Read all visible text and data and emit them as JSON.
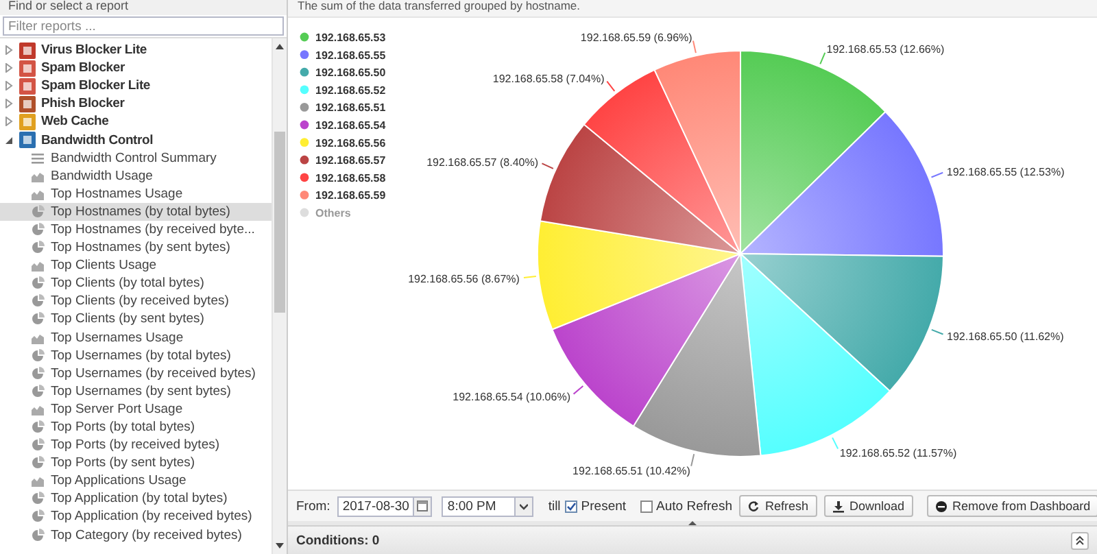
{
  "sidebar": {
    "title": "Find or select a report",
    "filter": {
      "placeholder": "Filter reports ..."
    },
    "tree": [
      {
        "label": "Virus Blocker Lite",
        "expanded": false,
        "selected": false
      },
      {
        "label": "Spam Blocker",
        "expanded": false,
        "selected": false
      },
      {
        "label": "Spam Blocker Lite",
        "expanded": false,
        "selected": false
      },
      {
        "label": "Phish Blocker",
        "expanded": false,
        "selected": false
      },
      {
        "label": "Web Cache",
        "expanded": false,
        "selected": false
      },
      {
        "label": "Bandwidth Control",
        "expanded": true,
        "selected": false,
        "children": [
          {
            "label": "Bandwidth Control Summary",
            "kind": "text",
            "selected": false
          },
          {
            "label": "Bandwidth Usage",
            "kind": "area",
            "selected": false
          },
          {
            "label": "Top Hostnames Usage",
            "kind": "area",
            "selected": false
          },
          {
            "label": "Top Hostnames (by total bytes)",
            "kind": "pie",
            "selected": true
          },
          {
            "label": "Top Hostnames (by received byte...",
            "kind": "pie",
            "selected": false
          },
          {
            "label": "Top Hostnames (by sent bytes)",
            "kind": "pie",
            "selected": false
          },
          {
            "label": "Top Clients Usage",
            "kind": "area",
            "selected": false
          },
          {
            "label": "Top Clients (by total bytes)",
            "kind": "pie",
            "selected": false
          },
          {
            "label": "Top Clients (by received bytes)",
            "kind": "pie",
            "selected": false
          },
          {
            "label": "Top Clients (by sent bytes)",
            "kind": "pie",
            "selected": false
          },
          {
            "label": "Top Usernames Usage",
            "kind": "area",
            "selected": false
          },
          {
            "label": "Top Usernames (by total bytes)",
            "kind": "pie",
            "selected": false
          },
          {
            "label": "Top Usernames (by received bytes)",
            "kind": "pie",
            "selected": false
          },
          {
            "label": "Top Usernames (by sent bytes)",
            "kind": "pie",
            "selected": false
          },
          {
            "label": "Top Server Port Usage",
            "kind": "area",
            "selected": false
          },
          {
            "label": "Top Ports (by total bytes)",
            "kind": "pie",
            "selected": false
          },
          {
            "label": "Top Ports (by received bytes)",
            "kind": "pie",
            "selected": false
          },
          {
            "label": "Top Ports (by sent bytes)",
            "kind": "pie",
            "selected": false
          },
          {
            "label": "Top Applications Usage",
            "kind": "area",
            "selected": false
          },
          {
            "label": "Top Application (by total bytes)",
            "kind": "pie",
            "selected": false
          },
          {
            "label": "Top Application (by received bytes)",
            "kind": "pie",
            "selected": false
          },
          {
            "label": "Top Category (by received bytes)",
            "kind": "pie",
            "selected": false
          }
        ]
      }
    ]
  },
  "report": {
    "description": "The sum of the data transferred grouped by hostname.",
    "slices": [
      {
        "color": "#55cc55",
        "hidden": false
      },
      {
        "color": "#7777ff",
        "hidden": false
      },
      {
        "color": "#44aaaa",
        "hidden": false
      },
      {
        "color": "#55ffff",
        "hidden": false
      },
      {
        "color": "#999999",
        "hidden": false
      },
      {
        "color": "#bb44cc",
        "hidden": false
      },
      {
        "color": "#ffee33",
        "hidden": false
      },
      {
        "color": "#bb4444",
        "hidden": false
      },
      {
        "color": "#ff4444",
        "hidden": false
      },
      {
        "color": "#ff8877",
        "hidden": false
      },
      {
        "color": "#dddddd",
        "hidden": true
      }
    ],
    "chart_data": {
      "type": "pie",
      "legend": true,
      "categories": [
        "192.168.65.53",
        "192.168.65.55",
        "192.168.65.50",
        "192.168.65.52",
        "192.168.65.51",
        "192.168.65.54",
        "192.168.65.56",
        "192.168.65.57",
        "192.168.65.58",
        "192.168.65.59",
        "Others"
      ],
      "values": [
        12.66,
        12.53,
        11.62,
        11.57,
        10.42,
        10.06,
        8.67,
        8.4,
        7.04,
        6.96,
        null
      ],
      "value_labels": [
        "192.168.65.53 (12.66%)",
        "192.168.65.55 (12.53%)",
        "192.168.65.50 (11.62%)",
        "192.168.65.52 (11.57%)",
        "192.168.65.51 (10.42%)",
        "192.168.65.54 (10.06%)",
        "192.168.65.56 (8.67%)",
        "192.168.65.57 (8.40%)",
        "192.168.65.58 (7.04%)",
        "192.168.65.59 (6.96%)",
        null
      ]
    }
  },
  "toolbar": {
    "from_label": "From:",
    "date": "2017-08-30",
    "time": "8:00 PM",
    "till_label": "till",
    "present": {
      "label": "Present",
      "checked": true
    },
    "auto_refresh": {
      "label": "Auto Refresh",
      "checked": false
    },
    "buttons": [
      {
        "label": "Refresh",
        "kind": "refresh"
      },
      {
        "label": "Download",
        "kind": "download"
      },
      {
        "label": "Remove from Dashboard",
        "kind": "remove"
      }
    ]
  },
  "conditions": {
    "label": "Conditions: 0"
  }
}
